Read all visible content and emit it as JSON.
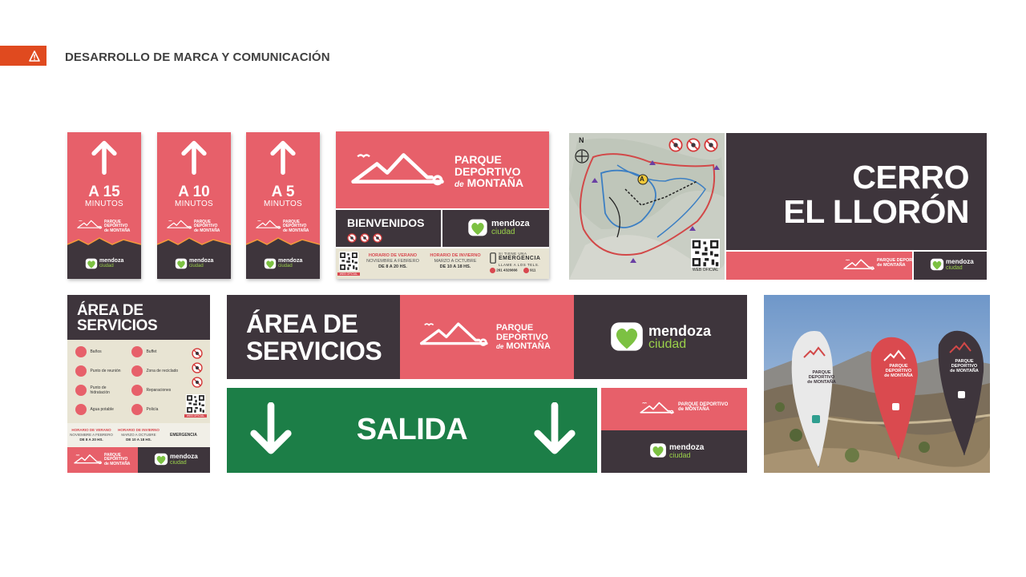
{
  "header": {
    "title": "DESARROLLO DE MARCA Y COMUNICACIÓN"
  },
  "brand": {
    "park_line1": "PARQUE",
    "park_line2": "DEPORTIVO",
    "park_line3_de": "de",
    "park_line3": "MONTAÑA",
    "city_word": "mendoza",
    "city_sub": "ciudad"
  },
  "arrow_signs": [
    {
      "distance": "A 15",
      "unit": "MINUTOS"
    },
    {
      "distance": "A 10",
      "unit": "MINUTOS"
    },
    {
      "distance": "A 5",
      "unit": "MINUTOS"
    }
  ],
  "welcome_sign": {
    "welcome": "BIENVENIDOS",
    "summer_title": "HORARIO DE VERANO",
    "summer_months": "NOVIEMBRE A FEBRERO",
    "summer_hours": "DE 8 A 20 HS.",
    "winter_title": "HORARIO DE INVIERNO",
    "winter_months": "MARZO A OCTUBRE",
    "winter_hours": "DE 10 A 18 HS.",
    "emergency_l1": "SI TIENE UNA",
    "emergency_l2": "EMERGENCIA",
    "emergency_l3": "LLAME A LOS TELS.",
    "phone": "261 4326666",
    "phone2": "911",
    "web": "WEB OFICIAL"
  },
  "map_sign": {
    "north": "N",
    "marker_a": "A",
    "web": "WEB OFICIAL",
    "name_l1": "CERRO",
    "name_l2": "EL LLORÓN"
  },
  "services_panel": {
    "title_l1": "ÁREA DE",
    "title_l2": "SERVICIOS",
    "services": [
      "Baños",
      "Buffet",
      "Punto de reunión",
      "Zona de reciclado",
      "Punto de hidratación",
      "Reparaciones",
      "Agua potable",
      "Policía"
    ],
    "summer_title": "HORARIO DE VERANO",
    "summer_months": "NOVIEMBRE A FEBRERO",
    "summer_hours": "DE 8 A 20 HS.",
    "winter_title": "HORARIO DE INVIERNO",
    "winter_months": "MARZO A OCTUBRE",
    "winter_hours": "DE 10 A 18 HS.",
    "emergency": "EMERGENCIA",
    "web": "WEB OFICIAL"
  },
  "services_banner": {
    "title_l1": "ÁREA DE",
    "title_l2": "SERVICIOS"
  },
  "exit_banner": {
    "label": "SALIDA"
  },
  "colors": {
    "coral": "#E7606A",
    "dark": "#3E353C",
    "green": "#1C7E47",
    "accent_orange": "#E04A1F"
  }
}
